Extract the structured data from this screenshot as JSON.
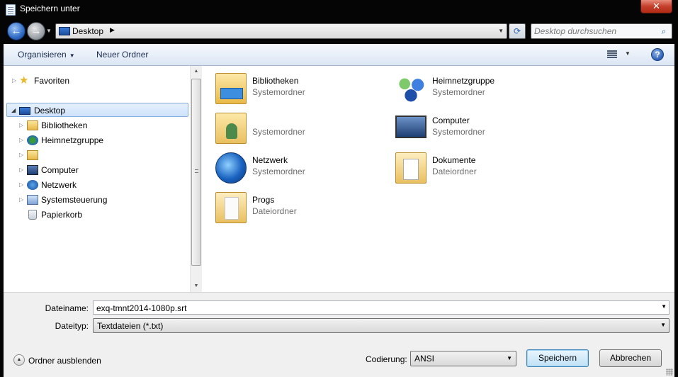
{
  "window": {
    "title": "Speichern unter",
    "close_glyph": "✕"
  },
  "address": {
    "location": "Desktop",
    "search_placeholder": "Desktop durchsuchen"
  },
  "toolbar": {
    "organize_label": "Organisieren",
    "new_folder_label": "Neuer Ordner",
    "help_glyph": "?"
  },
  "nav": {
    "items": [
      {
        "label": "Favoriten",
        "icon": "star-icon"
      },
      {
        "label": "Desktop",
        "icon": "desktop-icon",
        "selected": true
      },
      {
        "label": "Bibliotheken",
        "icon": "libraries-icon"
      },
      {
        "label": "Heimnetzgruppe",
        "icon": "homegroup-icon"
      },
      {
        "label": "",
        "icon": "user-folder-icon"
      },
      {
        "label": "Computer",
        "icon": "computer-icon"
      },
      {
        "label": "Netzwerk",
        "icon": "network-icon"
      },
      {
        "label": "Systemsteuerung",
        "icon": "control-panel-icon"
      },
      {
        "label": "Papierkorb",
        "icon": "recycle-bin-icon"
      }
    ]
  },
  "content": {
    "tiles": [
      {
        "name": "Bibliotheken",
        "type": "Systemordner",
        "icon": "libraries-icon"
      },
      {
        "name": "Heimnetzgruppe",
        "type": "Systemordner",
        "icon": "homegroup-icon"
      },
      {
        "name": "",
        "type": "Systemordner",
        "icon": "user-folder-icon"
      },
      {
        "name": "Computer",
        "type": "Systemordner",
        "icon": "computer-icon"
      },
      {
        "name": "Netzwerk",
        "type": "Systemordner",
        "icon": "network-icon"
      },
      {
        "name": "Dokumente",
        "type": "Dateiordner",
        "icon": "documents-folder-icon"
      },
      {
        "name": "Progs",
        "type": "Dateiordner",
        "icon": "folder-icon"
      }
    ]
  },
  "form": {
    "filename_label": "Dateiname:",
    "filename_value": "exq-tmnt2014-1080p.srt",
    "filetype_label": "Dateityp:",
    "filetype_value": "Textdateien (*.txt)",
    "hide_folders_label": "Ordner ausblenden",
    "encoding_label": "Codierung:",
    "encoding_value": "ANSI",
    "save_label": "Speichern",
    "cancel_label": "Abbrechen"
  }
}
